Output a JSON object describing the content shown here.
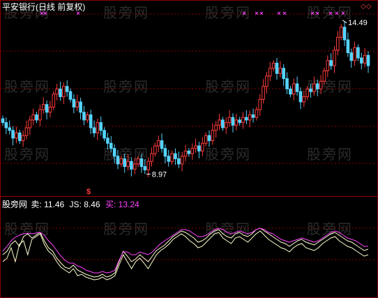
{
  "chart_data": [
    {
      "type": "candlestick",
      "title": "平安银行(日线 前复权)",
      "annotations": {
        "high_label": "14.49",
        "low_label": "8.97",
        "signal_glyph": "$"
      },
      "colors": {
        "up": "#ff3b3b",
        "down": "#54d4ff",
        "signal": "#ff44ff",
        "grid": "#8b0000",
        "high_label": "#ffffff"
      },
      "series": [
        {
          "name": "close",
          "values": [
            10.8,
            10.6,
            10.5,
            10.2,
            10.4,
            10.1,
            10.3,
            10.6,
            10.9,
            11.1,
            10.9,
            11.3,
            11.5,
            11.2,
            11.4,
            11.9,
            12.1,
            11.8,
            12.2,
            12.0,
            11.7,
            11.4,
            11.6,
            11.2,
            10.9,
            11.1,
            10.6,
            10.4,
            10.8,
            10.5,
            10.2,
            10.0,
            9.8,
            9.5,
            9.2,
            9.4,
            9.1,
            9.3,
            9.0,
            9.2,
            9.4,
            9.1,
            8.97,
            9.3,
            9.6,
            9.9,
            10.1,
            9.8,
            9.5,
            9.3,
            9.6,
            9.4,
            9.2,
            9.5,
            9.7,
            9.6,
            9.8,
            9.9,
            9.7,
            10.0,
            10.3,
            10.1,
            10.5,
            10.7,
            10.9,
            10.6,
            10.8,
            11.0,
            10.7,
            10.9,
            10.8,
            11.0,
            10.9,
            11.1,
            11.0,
            11.3,
            11.7,
            12.2,
            12.6,
            12.9,
            13.1,
            12.7,
            12.9,
            12.5,
            12.1,
            11.9,
            12.3,
            12.0,
            11.6,
            11.8,
            12.1,
            12.0,
            12.3,
            12.1,
            12.4,
            12.8,
            13.2,
            13.0,
            13.6,
            14.1,
            14.49,
            14.0,
            13.5,
            13.2,
            13.7,
            13.3,
            13.1,
            13.4,
            13.0
          ]
        }
      ],
      "ylim": [
        8.2,
        15.0
      ]
    },
    {
      "type": "line",
      "title": "股旁网",
      "indicators": [
        {
          "name": "卖",
          "value": "11.46",
          "color": "#ffffff"
        },
        {
          "name": "JS",
          "value": "8.46",
          "color": "#ffffff"
        },
        {
          "name": "买",
          "value": "13.24",
          "color": "#ff44ff"
        }
      ],
      "series": [
        {
          "name": "卖",
          "color": "#ffffd0",
          "values": [
            40,
            45,
            55,
            60,
            52,
            66,
            70,
            64,
            68,
            72,
            60,
            50,
            45,
            35,
            28,
            22,
            20,
            25,
            18,
            15,
            12,
            10,
            8,
            9,
            12,
            8,
            10,
            14,
            30,
            45,
            38,
            30,
            34,
            40,
            35,
            30,
            38,
            46,
            50,
            54,
            60,
            66,
            70,
            74,
            72,
            68,
            64,
            58,
            60,
            64,
            70,
            74,
            76,
            70,
            66,
            64,
            70,
            72,
            68,
            66,
            70,
            76,
            78,
            74,
            70,
            66,
            62,
            58,
            56,
            52,
            56,
            60,
            62,
            58,
            56,
            54,
            58,
            62,
            66,
            70,
            72,
            68,
            64,
            60,
            58,
            54,
            50,
            46,
            48
          ]
        },
        {
          "name": "JS",
          "color": "#ffffd0",
          "values": [
            30,
            35,
            50,
            30,
            55,
            60,
            40,
            62,
            66,
            70,
            55,
            45,
            40,
            30,
            22,
            18,
            14,
            20,
            10,
            12,
            8,
            6,
            4,
            5,
            8,
            4,
            6,
            10,
            25,
            40,
            30,
            20,
            30,
            35,
            28,
            20,
            30,
            40,
            46,
            50,
            55,
            62,
            66,
            70,
            66,
            60,
            56,
            50,
            52,
            58,
            64,
            70,
            72,
            64,
            60,
            56,
            64,
            66,
            62,
            58,
            64,
            70,
            74,
            68,
            62,
            58,
            54,
            50,
            48,
            44,
            50,
            54,
            56,
            50,
            48,
            46,
            50,
            56,
            60,
            64,
            66,
            60,
            56,
            52,
            50,
            46,
            42,
            38,
            40
          ]
        },
        {
          "name": "买",
          "color": "#ff44ff",
          "values": [
            45,
            52,
            60,
            65,
            68,
            70,
            71,
            70,
            71,
            72,
            68,
            60,
            54,
            46,
            38,
            32,
            28,
            28,
            24,
            22,
            18,
            16,
            14,
            14,
            16,
            14,
            15,
            18,
            32,
            44,
            44,
            40,
            40,
            44,
            42,
            40,
            44,
            50,
            56,
            60,
            64,
            68,
            72,
            76,
            76,
            74,
            70,
            66,
            66,
            68,
            72,
            76,
            78,
            76,
            72,
            70,
            72,
            74,
            72,
            70,
            72,
            76,
            78,
            76,
            72,
            70,
            66,
            62,
            60,
            58,
            60,
            62,
            64,
            62,
            60,
            58,
            60,
            64,
            68,
            72,
            74,
            72,
            68,
            64,
            62,
            60,
            56,
            52,
            52
          ]
        }
      ],
      "ylim": [
        0,
        100
      ]
    }
  ],
  "watermarks": [
    "股旁网",
    "股旁网",
    "股旁网",
    "股旁网",
    "股旁网",
    "股旁网",
    "股旁网",
    "股旁网",
    "股旁网",
    "股旁网",
    "股旁网",
    "股旁网"
  ],
  "corner_marker": "◇◇"
}
